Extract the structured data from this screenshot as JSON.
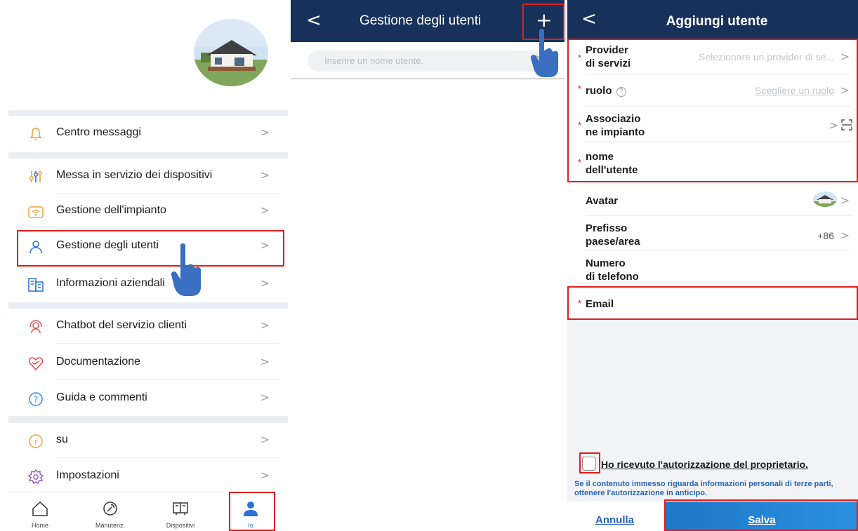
{
  "panel_me": {
    "menu": [
      {
        "label": "Centro messaggi",
        "icon": "bell-icon"
      },
      {
        "label": "Messa in servizio dei dispositivi",
        "icon": "sliders-icon"
      },
      {
        "label": "Gestione dell'impianto",
        "icon": "plant-icon"
      },
      {
        "label": "Gestione degli utenti",
        "icon": "user-icon"
      },
      {
        "label": "Informazioni aziendali",
        "icon": "building-icon"
      },
      {
        "label": "Chatbot del servizio clienti",
        "icon": "headset-icon"
      },
      {
        "label": "Documentazione",
        "icon": "document-icon"
      },
      {
        "label": "Guida e commenti",
        "icon": "help-icon"
      },
      {
        "label": "su",
        "icon": "info-icon"
      },
      {
        "label": "Impostazioni",
        "icon": "gear-icon"
      }
    ],
    "tabs": [
      {
        "label": "Home",
        "icon": "home-icon"
      },
      {
        "label": "Manutenz.",
        "icon": "wrench-icon"
      },
      {
        "label": "Dispositivi",
        "icon": "devices-icon"
      },
      {
        "label": "Io",
        "icon": "person-icon",
        "active": true
      }
    ],
    "accent_color": "#2a6fdb"
  },
  "panel_users": {
    "title": "Gestione degli utenti",
    "search_placeholder": "Inserire un nome utente."
  },
  "panel_add_user": {
    "title": "Aggiungi utente",
    "fields": {
      "provider": {
        "label_line1": "Provider",
        "label_line2": "di servizi",
        "value": "Selezionare un provider di se...",
        "required": true
      },
      "role": {
        "label": "ruolo",
        "value": "Scegliere un ruolo",
        "required": true
      },
      "plant": {
        "label_line1": "Associazio",
        "label_line2": "ne impianto",
        "required": true
      },
      "username": {
        "label_line1": "nome",
        "label_line2": "dell'utente",
        "required": true
      },
      "avatar": {
        "label": "Avatar"
      },
      "prefix": {
        "label_line1": "Prefisso",
        "label_line2": "paese/area",
        "value": "+86"
      },
      "phone": {
        "label_line1": "Numero",
        "label_line2": "di telefono"
      },
      "email": {
        "label": "Email",
        "required": true
      }
    },
    "auth_text": "Ho ricevuto l'autorizzazione del proprietario.",
    "auth_note": "Se il contenuto immesso riguarda informazioni personali di terze parti, ottenere l'autorizzazione in anticipo.",
    "cancel_label": "Annulla",
    "save_label": "Salva",
    "header_color": "#17315b",
    "highlight_color": "#e01d1d"
  }
}
